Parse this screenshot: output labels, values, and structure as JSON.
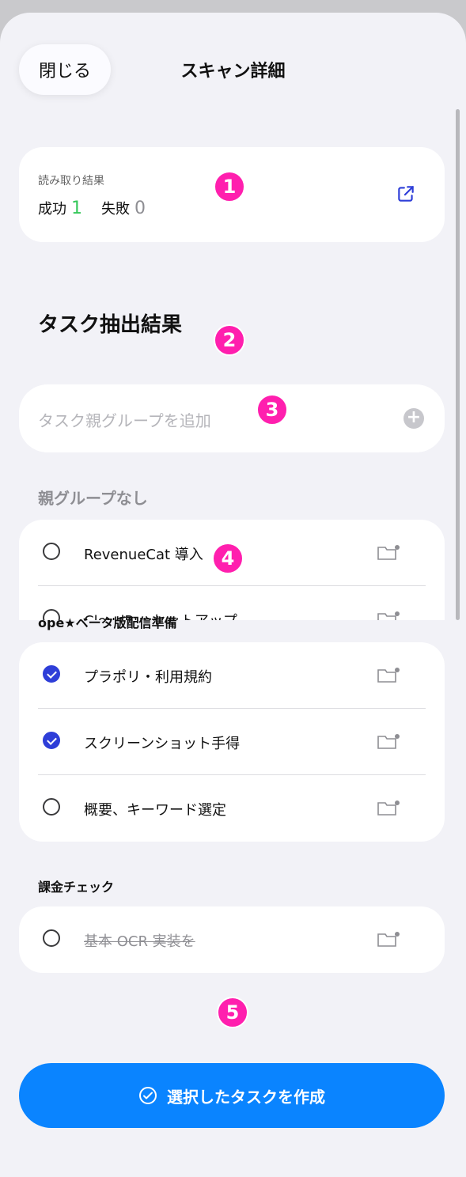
{
  "header": {
    "close_label": "閉じる",
    "title": "スキャン詳細"
  },
  "scan_result": {
    "label": "読み取り結果",
    "success_label": "成功",
    "success_count": "1",
    "fail_label": "失敗",
    "fail_count": "0"
  },
  "section_title": "タスク抽出結果",
  "add_group": {
    "placeholder": "タスク親グループを追加"
  },
  "groups": [
    {
      "label": "親グループなし",
      "items": [
        {
          "label": "RevenueCat 導入",
          "checked": false,
          "done": false
        },
        {
          "label": "CloudRunセットアップ",
          "checked": false,
          "done": false
        }
      ]
    },
    {
      "label": "ope★ベータ版配信準備",
      "items": [
        {
          "label": "プラポリ・利用規約",
          "checked": true,
          "done": false
        },
        {
          "label": "スクリーンショット手得",
          "checked": true,
          "done": false
        },
        {
          "label": "概要、キーワード選定",
          "checked": false,
          "done": false
        }
      ]
    },
    {
      "label": "課金チェック",
      "items": [
        {
          "label": "基本 OCR 実装を",
          "checked": false,
          "done": true
        }
      ]
    }
  ],
  "badges": [
    "1",
    "2",
    "3",
    "4",
    "5"
  ],
  "create_button": {
    "label": "選択したタスクを作成"
  },
  "colors": {
    "accent": "#0a84ff",
    "success": "#34c759",
    "check": "#2e3ed8",
    "badge": "#ff1fae"
  },
  "icons": [
    "open-external-icon",
    "plus-icon",
    "radio-icon",
    "folder-settings-icon",
    "check-circle-icon"
  ]
}
